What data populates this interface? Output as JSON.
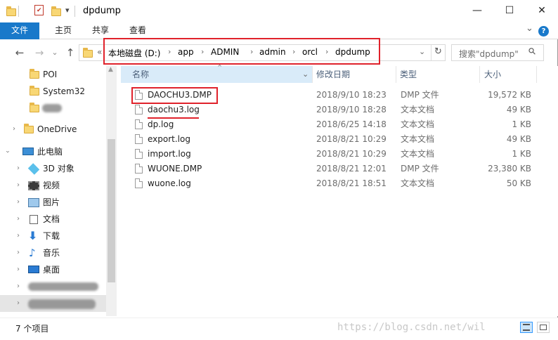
{
  "window": {
    "title": "dpdump",
    "minimize_symbol": "—",
    "maximize_symbol": "☐",
    "close_symbol": "✕"
  },
  "ribbon": {
    "tabs": [
      "文件",
      "主页",
      "共享",
      "查看"
    ],
    "collapse_symbol": "⌄",
    "help_symbol": "?"
  },
  "nav": {
    "back_symbol": "←",
    "forward_symbol": "→",
    "recent_symbol": "⌄",
    "up_symbol": "↑",
    "overflow_symbol": "«",
    "breadcrumbs": [
      "本地磁盘 (D:)",
      "app",
      "ADMIN",
      "admin",
      "orcl",
      "dpdump"
    ],
    "separator": "›",
    "dropdown_symbol": "⌄",
    "refresh_symbol": "↻",
    "search_placeholder": "搜索\"dpdump\"",
    "search_symbol": "⚲"
  },
  "sidebar": {
    "items": [
      {
        "label": "POI",
        "icon": "folder-icon"
      },
      {
        "label": "System32",
        "icon": "folder-icon"
      },
      {
        "label": "",
        "icon": "folder-icon"
      },
      {
        "label": "OneDrive",
        "icon": "folder-icon"
      },
      {
        "label": "此电脑",
        "icon": "computer-icon"
      },
      {
        "label": "3D 对象",
        "icon": "3d-objects-icon"
      },
      {
        "label": "视频",
        "icon": "video-icon"
      },
      {
        "label": "图片",
        "icon": "pictures-icon"
      },
      {
        "label": "文档",
        "icon": "documents-icon"
      },
      {
        "label": "下载",
        "icon": "downloads-icon"
      },
      {
        "label": "音乐",
        "icon": "music-icon"
      },
      {
        "label": "桌面",
        "icon": "desktop-icon"
      }
    ],
    "expand_symbol": "›"
  },
  "columns": {
    "name": "名称",
    "modified": "修改日期",
    "type": "类型",
    "size": "大小",
    "sort_symbol": "⌃",
    "dropdown_symbol": "⌄"
  },
  "files": [
    {
      "name": "DAOCHU3.DMP",
      "modified": "2018/9/10 18:23",
      "type": "DMP 文件",
      "size": "19,572 KB"
    },
    {
      "name": "daochu3.log",
      "modified": "2018/9/10 18:28",
      "type": "文本文档",
      "size": "49 KB"
    },
    {
      "name": "dp.log",
      "modified": "2018/6/25 14:18",
      "type": "文本文档",
      "size": "1 KB"
    },
    {
      "name": "export.log",
      "modified": "2018/8/21 10:29",
      "type": "文本文档",
      "size": "49 KB"
    },
    {
      "name": "import.log",
      "modified": "2018/8/21 10:29",
      "type": "文本文档",
      "size": "1 KB"
    },
    {
      "name": "WUONE.DMP",
      "modified": "2018/8/21 12:01",
      "type": "DMP 文件",
      "size": "23,380 KB"
    },
    {
      "name": "wuone.log",
      "modified": "2018/8/21 18:51",
      "type": "文本文档",
      "size": "50 KB"
    }
  ],
  "status": {
    "item_count": "7 个项目",
    "watermark": "https://blog.csdn.net/wil"
  },
  "colors": {
    "file_tab": "#1979ca",
    "annotation_red": "#e0222b",
    "selection": "#e5e5e5",
    "header_text": "#4c607a"
  }
}
